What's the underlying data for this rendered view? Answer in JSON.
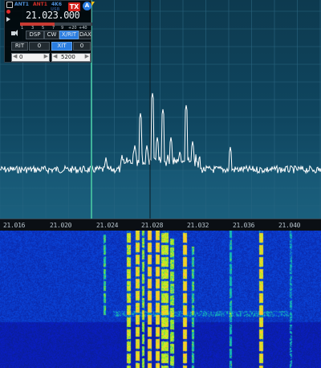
{
  "slice": {
    "rx_antenna": "ANT1",
    "tx_antenna": "ANT1",
    "filter_width": "4K6",
    "mode": "USB",
    "tx_label": "TX",
    "slice_letter": "A",
    "frequency": "21.023.000",
    "smeter_scale": [
      "1",
      "3",
      "5",
      "7",
      "9",
      "+20",
      "+40"
    ],
    "smeter_level": 0.48,
    "tabs": [
      {
        "label": "DSP",
        "active": false
      },
      {
        "label": "CW",
        "active": false
      },
      {
        "label": "X/RIT",
        "active": true
      },
      {
        "label": "DAX",
        "active": false
      }
    ],
    "rit_label": "RIT",
    "rit_value": "0",
    "xit_label": "XIT",
    "xit_value": "0",
    "rit_step": "0",
    "xit_step": "5200"
  },
  "frequency_scale": {
    "labels": [
      "21.016",
      "21.020",
      "21.024",
      "21.028",
      "21.032",
      "21.036",
      "21.040"
    ]
  },
  "colors": {
    "tx_red": "#d6221c",
    "accent_blue": "#2a7de1",
    "marker_yellow": "#f2c31b",
    "slice_line": "#3fb39a"
  }
}
